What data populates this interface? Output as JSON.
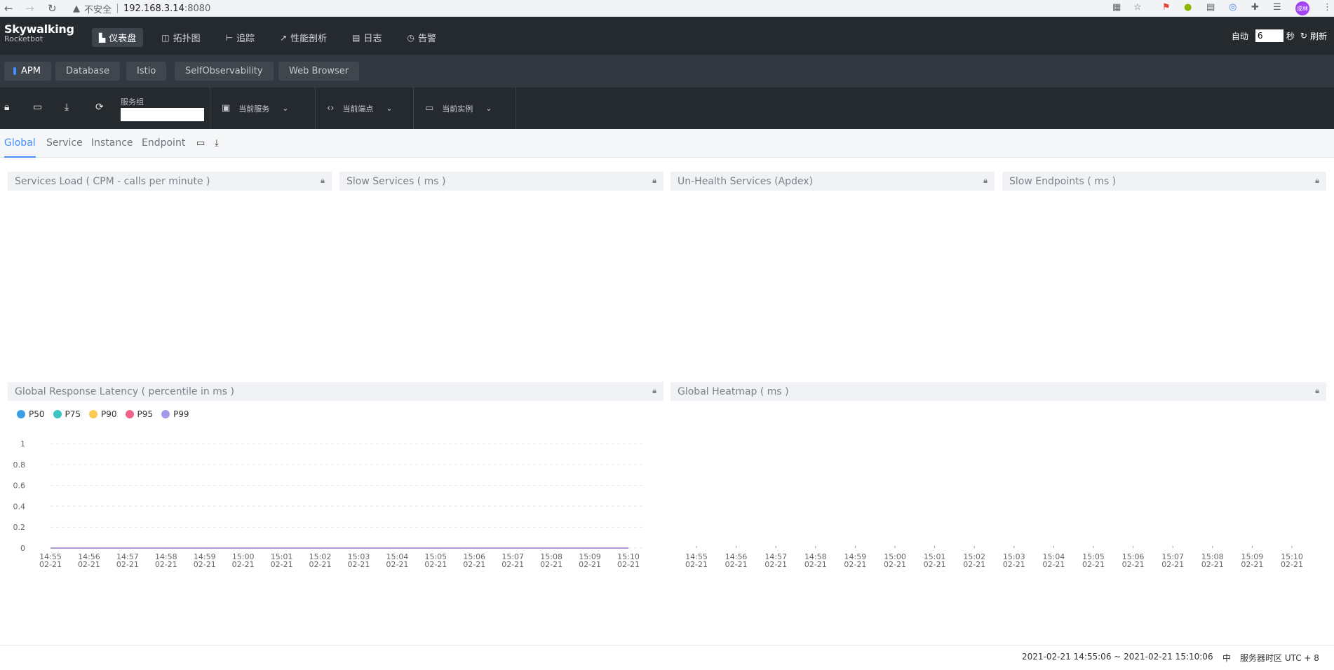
{
  "browser": {
    "insecure_label": "不安全",
    "url_host": "192.168.3.14",
    "url_port": ":8080",
    "avatar_text": "成林"
  },
  "header": {
    "logo_line1": "Skywalking",
    "logo_line2": "Rocketbot",
    "nav": [
      {
        "label": "仪表盘",
        "icon": "dashboard-icon",
        "active": true
      },
      {
        "label": "拓扑图",
        "icon": "topology-icon",
        "active": false
      },
      {
        "label": "追踪",
        "icon": "trace-icon",
        "active": false
      },
      {
        "label": "性能剖析",
        "icon": "profile-icon",
        "active": false
      },
      {
        "label": "日志",
        "icon": "log-icon",
        "active": false
      },
      {
        "label": "告警",
        "icon": "alarm-icon",
        "active": false
      }
    ],
    "auto_label": "自动",
    "interval_value": "6",
    "seconds_label": "秒",
    "refresh_label": "刷新"
  },
  "tabs": [
    {
      "label": "APM",
      "active": true
    },
    {
      "label": "Database",
      "active": false
    },
    {
      "label": "Istio",
      "active": false
    },
    {
      "label": "SelfObservability",
      "active": false
    },
    {
      "label": "Web Browser",
      "active": false
    }
  ],
  "toolbar": {
    "group_label": "服务组",
    "group_value": "",
    "service_label": "当前服务",
    "endpoint_label": "当前端点",
    "instance_label": "当前实例"
  },
  "dashboard_tabs": [
    {
      "label": "Global",
      "active": true
    },
    {
      "label": "Service",
      "active": false
    },
    {
      "label": "Instance",
      "active": false
    },
    {
      "label": "Endpoint",
      "active": false
    }
  ],
  "panels": {
    "services_load": "Services Load ( CPM - calls per minute )",
    "slow_services": "Slow Services ( ms )",
    "unhealth_services": "Un-Health Services (Apdex)",
    "slow_endpoints": "Slow Endpoints ( ms )",
    "global_latency": "Global Response Latency ( percentile in ms )",
    "global_heatmap": "Global Heatmap ( ms )"
  },
  "colors": {
    "accent": "#448dfe",
    "header_bg": "#252a2f",
    "tabs_bg": "#333840"
  },
  "chart_data": [
    {
      "type": "line",
      "title": "Global Response Latency ( percentile in ms )",
      "categories": [
        "14:55\n02-21",
        "14:56\n02-21",
        "14:57\n02-21",
        "14:58\n02-21",
        "14:59\n02-21",
        "15:00\n02-21",
        "15:01\n02-21",
        "15:02\n02-21",
        "15:03\n02-21",
        "15:04\n02-21",
        "15:05\n02-21",
        "15:06\n02-21",
        "15:07\n02-21",
        "15:08\n02-21",
        "15:09\n02-21",
        "15:10\n02-21"
      ],
      "series": [
        {
          "name": "P50",
          "color": "#3a9fe6",
          "values": [
            0,
            0,
            0,
            0,
            0,
            0,
            0,
            0,
            0,
            0,
            0,
            0,
            0,
            0,
            0,
            0
          ]
        },
        {
          "name": "P75",
          "color": "#3cc5c0",
          "values": [
            0,
            0,
            0,
            0,
            0,
            0,
            0,
            0,
            0,
            0,
            0,
            0,
            0,
            0,
            0,
            0
          ]
        },
        {
          "name": "P90",
          "color": "#ffc853",
          "values": [
            0,
            0,
            0,
            0,
            0,
            0,
            0,
            0,
            0,
            0,
            0,
            0,
            0,
            0,
            0,
            0
          ]
        },
        {
          "name": "P95",
          "color": "#f4648a",
          "values": [
            0,
            0,
            0,
            0,
            0,
            0,
            0,
            0,
            0,
            0,
            0,
            0,
            0,
            0,
            0,
            0
          ]
        },
        {
          "name": "P99",
          "color": "#a19ae8",
          "values": [
            0,
            0,
            0,
            0,
            0,
            0,
            0,
            0,
            0,
            0,
            0,
            0,
            0,
            0,
            0,
            0
          ]
        }
      ],
      "yticks": [
        0,
        0.2,
        0.4,
        0.6,
        0.8,
        1
      ],
      "ylim": [
        0,
        1
      ],
      "legend": "top-left",
      "grid": true
    },
    {
      "type": "heatmap",
      "title": "Global Heatmap ( ms )",
      "categories": [
        "14:55\n02-21",
        "14:56\n02-21",
        "14:57\n02-21",
        "14:58\n02-21",
        "14:59\n02-21",
        "15:00\n02-21",
        "15:01\n02-21",
        "15:02\n02-21",
        "15:03\n02-21",
        "15:04\n02-21",
        "15:05\n02-21",
        "15:06\n02-21",
        "15:07\n02-21",
        "15:08\n02-21",
        "15:09\n02-21",
        "15:10\n02-21"
      ],
      "values": []
    }
  ],
  "footer": {
    "time_range": "2021-02-21 14:55:06 ~ 2021-02-21 15:10:06",
    "lang": "中",
    "timezone": "服务器时区 UTC + 8"
  }
}
